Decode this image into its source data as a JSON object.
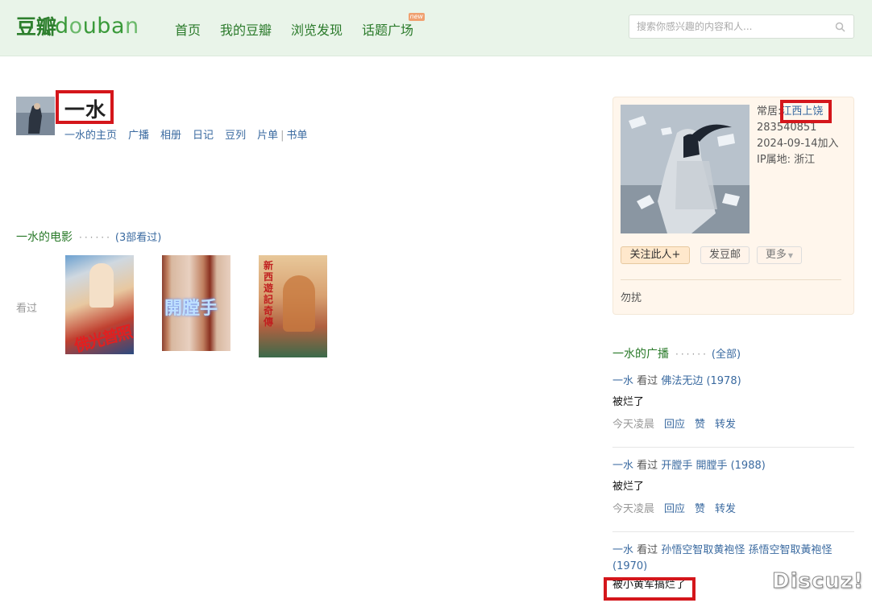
{
  "header": {
    "logo_cn": "豆瓣",
    "logo_en_1": "d",
    "logo_en_o1": "o",
    "logo_en_2": "uba",
    "logo_en_3": "n",
    "nav": [
      "首页",
      "我的豆瓣",
      "浏览发现",
      "话题广场"
    ],
    "new_badge": "new",
    "search_placeholder": "搜索你感兴趣的内容和人..."
  },
  "profile": {
    "name": "一水",
    "links": [
      "一水的主页",
      "广播",
      "相册",
      "日记",
      "豆列",
      "片单",
      "书单"
    ],
    "link_separator": "|"
  },
  "movies": {
    "title": "一水的电影",
    "dots": "······",
    "count": "(3部看过)",
    "seen_label": "看过",
    "poster_texts": [
      "佛光普照",
      "開膛手",
      "新 西遊記 奇傳"
    ]
  },
  "card": {
    "residence_label": "常居:",
    "residence": "江西上饶",
    "user_id": "283540851",
    "joined": "2024-09-14加入",
    "ip": "IP属地: 浙江",
    "follow_button": "关注此人+",
    "mail_button": "发豆邮",
    "more_button": "更多",
    "status": "勿扰"
  },
  "broadcasts": {
    "title": "一水的广播",
    "dots": "······",
    "all": "(全部)",
    "items": [
      {
        "user": "一水",
        "verb": "看过",
        "target": "佛法无边 (1978)",
        "comment": "被烂了",
        "time": "今天凌晨",
        "actions": [
          "回应",
          "赞",
          "转发"
        ]
      },
      {
        "user": "一水",
        "verb": "看过",
        "target": "开膛手 開膛手 (1988)",
        "comment": "被烂了",
        "time": "今天凌晨",
        "actions": [
          "回应",
          "赞",
          "转发"
        ]
      },
      {
        "user": "一水",
        "verb": "看过",
        "target": "孙悟空智取黄袍怪 孫悟空智取黃袍怪 (1970)",
        "comment": "被小黄军搞烂了"
      }
    ]
  },
  "watermark": "Discuz!"
}
